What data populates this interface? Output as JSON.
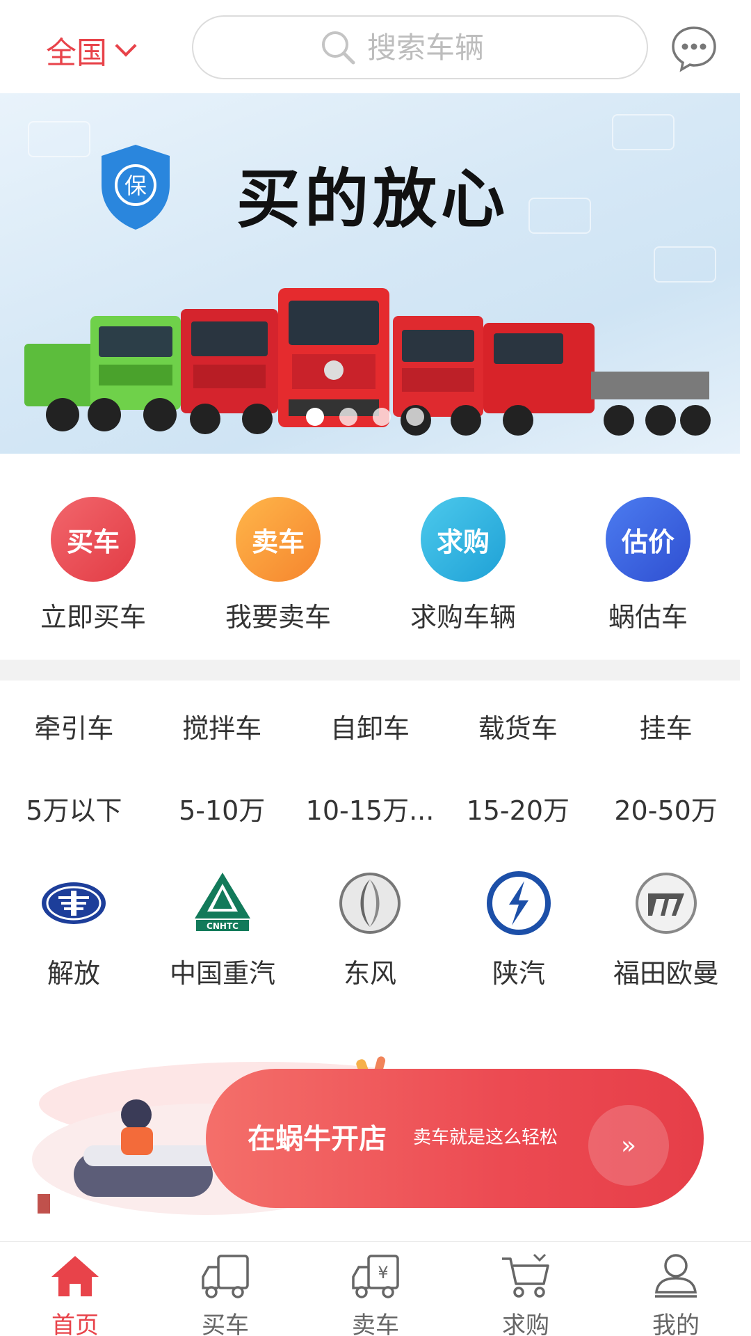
{
  "header": {
    "region": "全国",
    "search_placeholder": "搜索车辆"
  },
  "banner": {
    "title": "买的放心",
    "shield_text": "保",
    "slides": 4,
    "active_slide": 0
  },
  "quick_actions": [
    {
      "badge": "买车",
      "label": "立即买车",
      "color": "#e9474f"
    },
    {
      "badge": "卖车",
      "label": "我要卖车",
      "color": "#f79a3c"
    },
    {
      "badge": "求购",
      "label": "求购车辆",
      "color": "#30b5e0"
    },
    {
      "badge": "估价",
      "label": "蜗估车",
      "color": "#3a5fe0"
    }
  ],
  "categories": [
    "牵引车",
    "搅拌车",
    "自卸车",
    "载货车",
    "挂车"
  ],
  "price_ranges": [
    "5万以下",
    "5-10万",
    "10-15万...",
    "15-20万",
    "20-50万"
  ],
  "brands": [
    {
      "name": "解放",
      "icon": "faw-logo-icon"
    },
    {
      "name": "中国重汽",
      "icon": "cnhtc-logo-icon"
    },
    {
      "name": "东风",
      "icon": "dongfeng-logo-icon"
    },
    {
      "name": "陕汽",
      "icon": "shacman-logo-icon"
    },
    {
      "name": "福田欧曼",
      "icon": "foton-logo-icon"
    }
  ],
  "promo": {
    "title": "在蜗牛开店",
    "subtitle": "卖车就是这么轻松",
    "arrow": "»"
  },
  "tabbar": [
    {
      "label": "首页",
      "icon": "home-icon",
      "active": true
    },
    {
      "label": "买车",
      "icon": "truck-icon",
      "active": false
    },
    {
      "label": "卖车",
      "icon": "truck-yuan-icon",
      "active": false
    },
    {
      "label": "求购",
      "icon": "cart-icon",
      "active": false
    },
    {
      "label": "我的",
      "icon": "user-icon",
      "active": false
    }
  ],
  "colors": {
    "accent": "#e8434a"
  }
}
